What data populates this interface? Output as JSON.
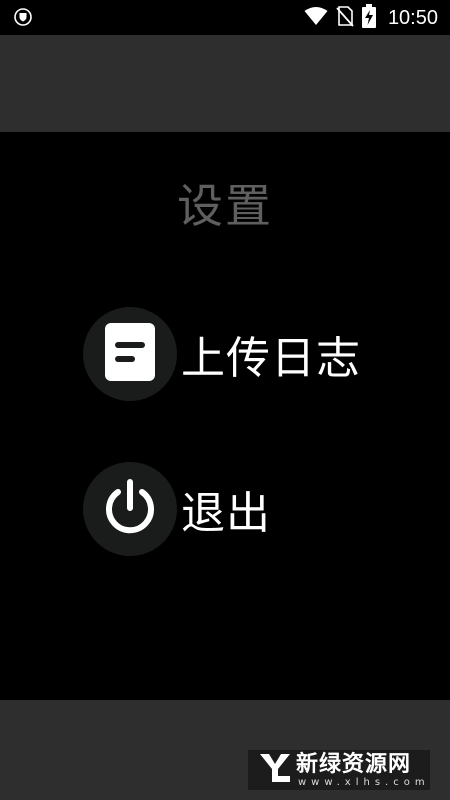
{
  "status_bar": {
    "time": "10:50",
    "icons": [
      "shield-icon",
      "wifi-icon",
      "no-sim-icon",
      "battery-charging-icon"
    ]
  },
  "screen": {
    "title": "设置",
    "items": [
      {
        "label": "上传日志",
        "icon": "document-icon"
      },
      {
        "label": "退出",
        "icon": "power-icon"
      }
    ]
  },
  "watermark": {
    "title": "新绿资源网",
    "subtitle": "www.xlhs.com",
    "logo": "xl-logo-icon"
  },
  "colors": {
    "background": "#000000",
    "bar": "#2e2e2e",
    "title_text": "#5f5f5f",
    "item_text": "#ffffff",
    "icon_circle": "#1a1c1b"
  }
}
